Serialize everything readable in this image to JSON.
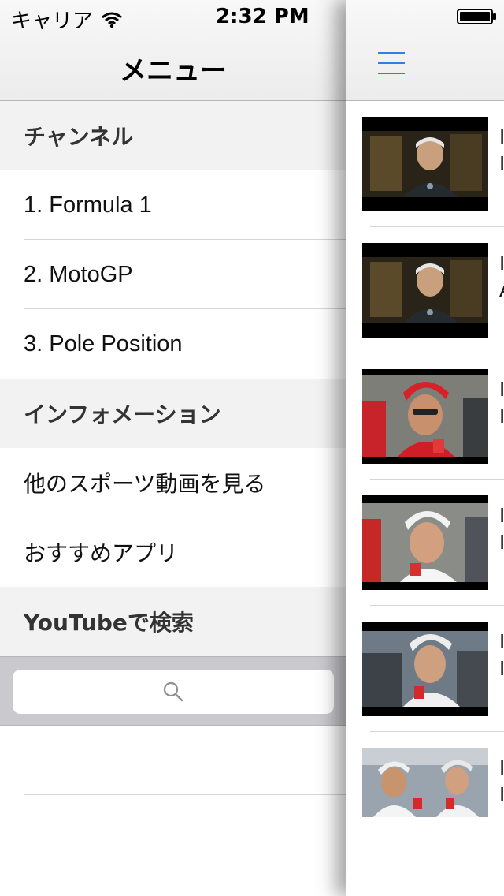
{
  "status_bar": {
    "carrier": "キャリア",
    "time": "2:32 PM"
  },
  "menu": {
    "title": "メニュー",
    "sections": [
      {
        "header": "チャンネル",
        "items": [
          "1. Formula 1",
          "2. MotoGP",
          "3. Pole Position"
        ]
      },
      {
        "header": "インフォメーション",
        "items": [
          "他のスポーツ動画を見る",
          "おすすめアプリ"
        ]
      },
      {
        "header": "YouTubeで検索",
        "items": []
      }
    ]
  },
  "search": {
    "placeholder": ""
  },
  "content": {
    "videos": [
      {
        "title_line1": "I",
        "title_line2": "I",
        "thumb": "driver-interview-night"
      },
      {
        "title_line1": "I",
        "title_line2": "A",
        "thumb": "driver-interview-night"
      },
      {
        "title_line1": "I",
        "title_line2": "I",
        "thumb": "driver-interview-red-cap"
      },
      {
        "title_line1": "I",
        "title_line2": "I",
        "thumb": "driver-interview-white-cap"
      },
      {
        "title_line1": "I",
        "title_line2": "I",
        "thumb": "driver-interview-crowd"
      },
      {
        "title_line1": "I",
        "title_line2": "I",
        "thumb": "team-interview-paddock"
      }
    ]
  },
  "colors": {
    "accent": "#2f7fe8",
    "section_bg": "#f2f2f2",
    "search_bar_bg": "#c9c9ce"
  }
}
